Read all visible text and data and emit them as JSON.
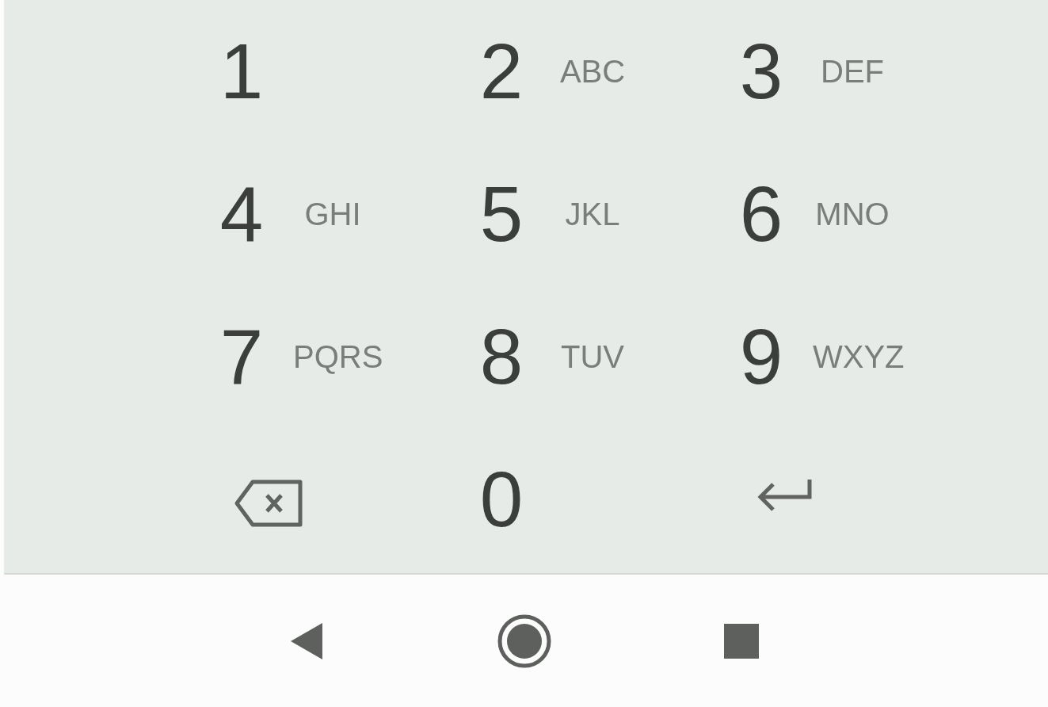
{
  "keypad": {
    "keys": [
      {
        "kind": "digit",
        "digit": "1"
      },
      {
        "kind": "digit",
        "digit": "2",
        "letters": "ABC"
      },
      {
        "kind": "digit",
        "digit": "3",
        "letters": "DEF"
      },
      {
        "kind": "digit",
        "digit": "4",
        "letters": "GHI"
      },
      {
        "kind": "digit",
        "digit": "5",
        "letters": "JKL"
      },
      {
        "kind": "digit",
        "digit": "6",
        "letters": "MNO"
      },
      {
        "kind": "digit",
        "digit": "7",
        "letters": "PQRS"
      },
      {
        "kind": "digit",
        "digit": "8",
        "letters": "TUV"
      },
      {
        "kind": "digit",
        "digit": "9",
        "letters": "WXYZ"
      },
      {
        "kind": "backspace"
      },
      {
        "kind": "digit",
        "digit": "0"
      },
      {
        "kind": "enter"
      }
    ]
  },
  "nav_bar": {
    "buttons": [
      {
        "kind": "back"
      },
      {
        "kind": "home"
      },
      {
        "kind": "recents"
      }
    ]
  }
}
